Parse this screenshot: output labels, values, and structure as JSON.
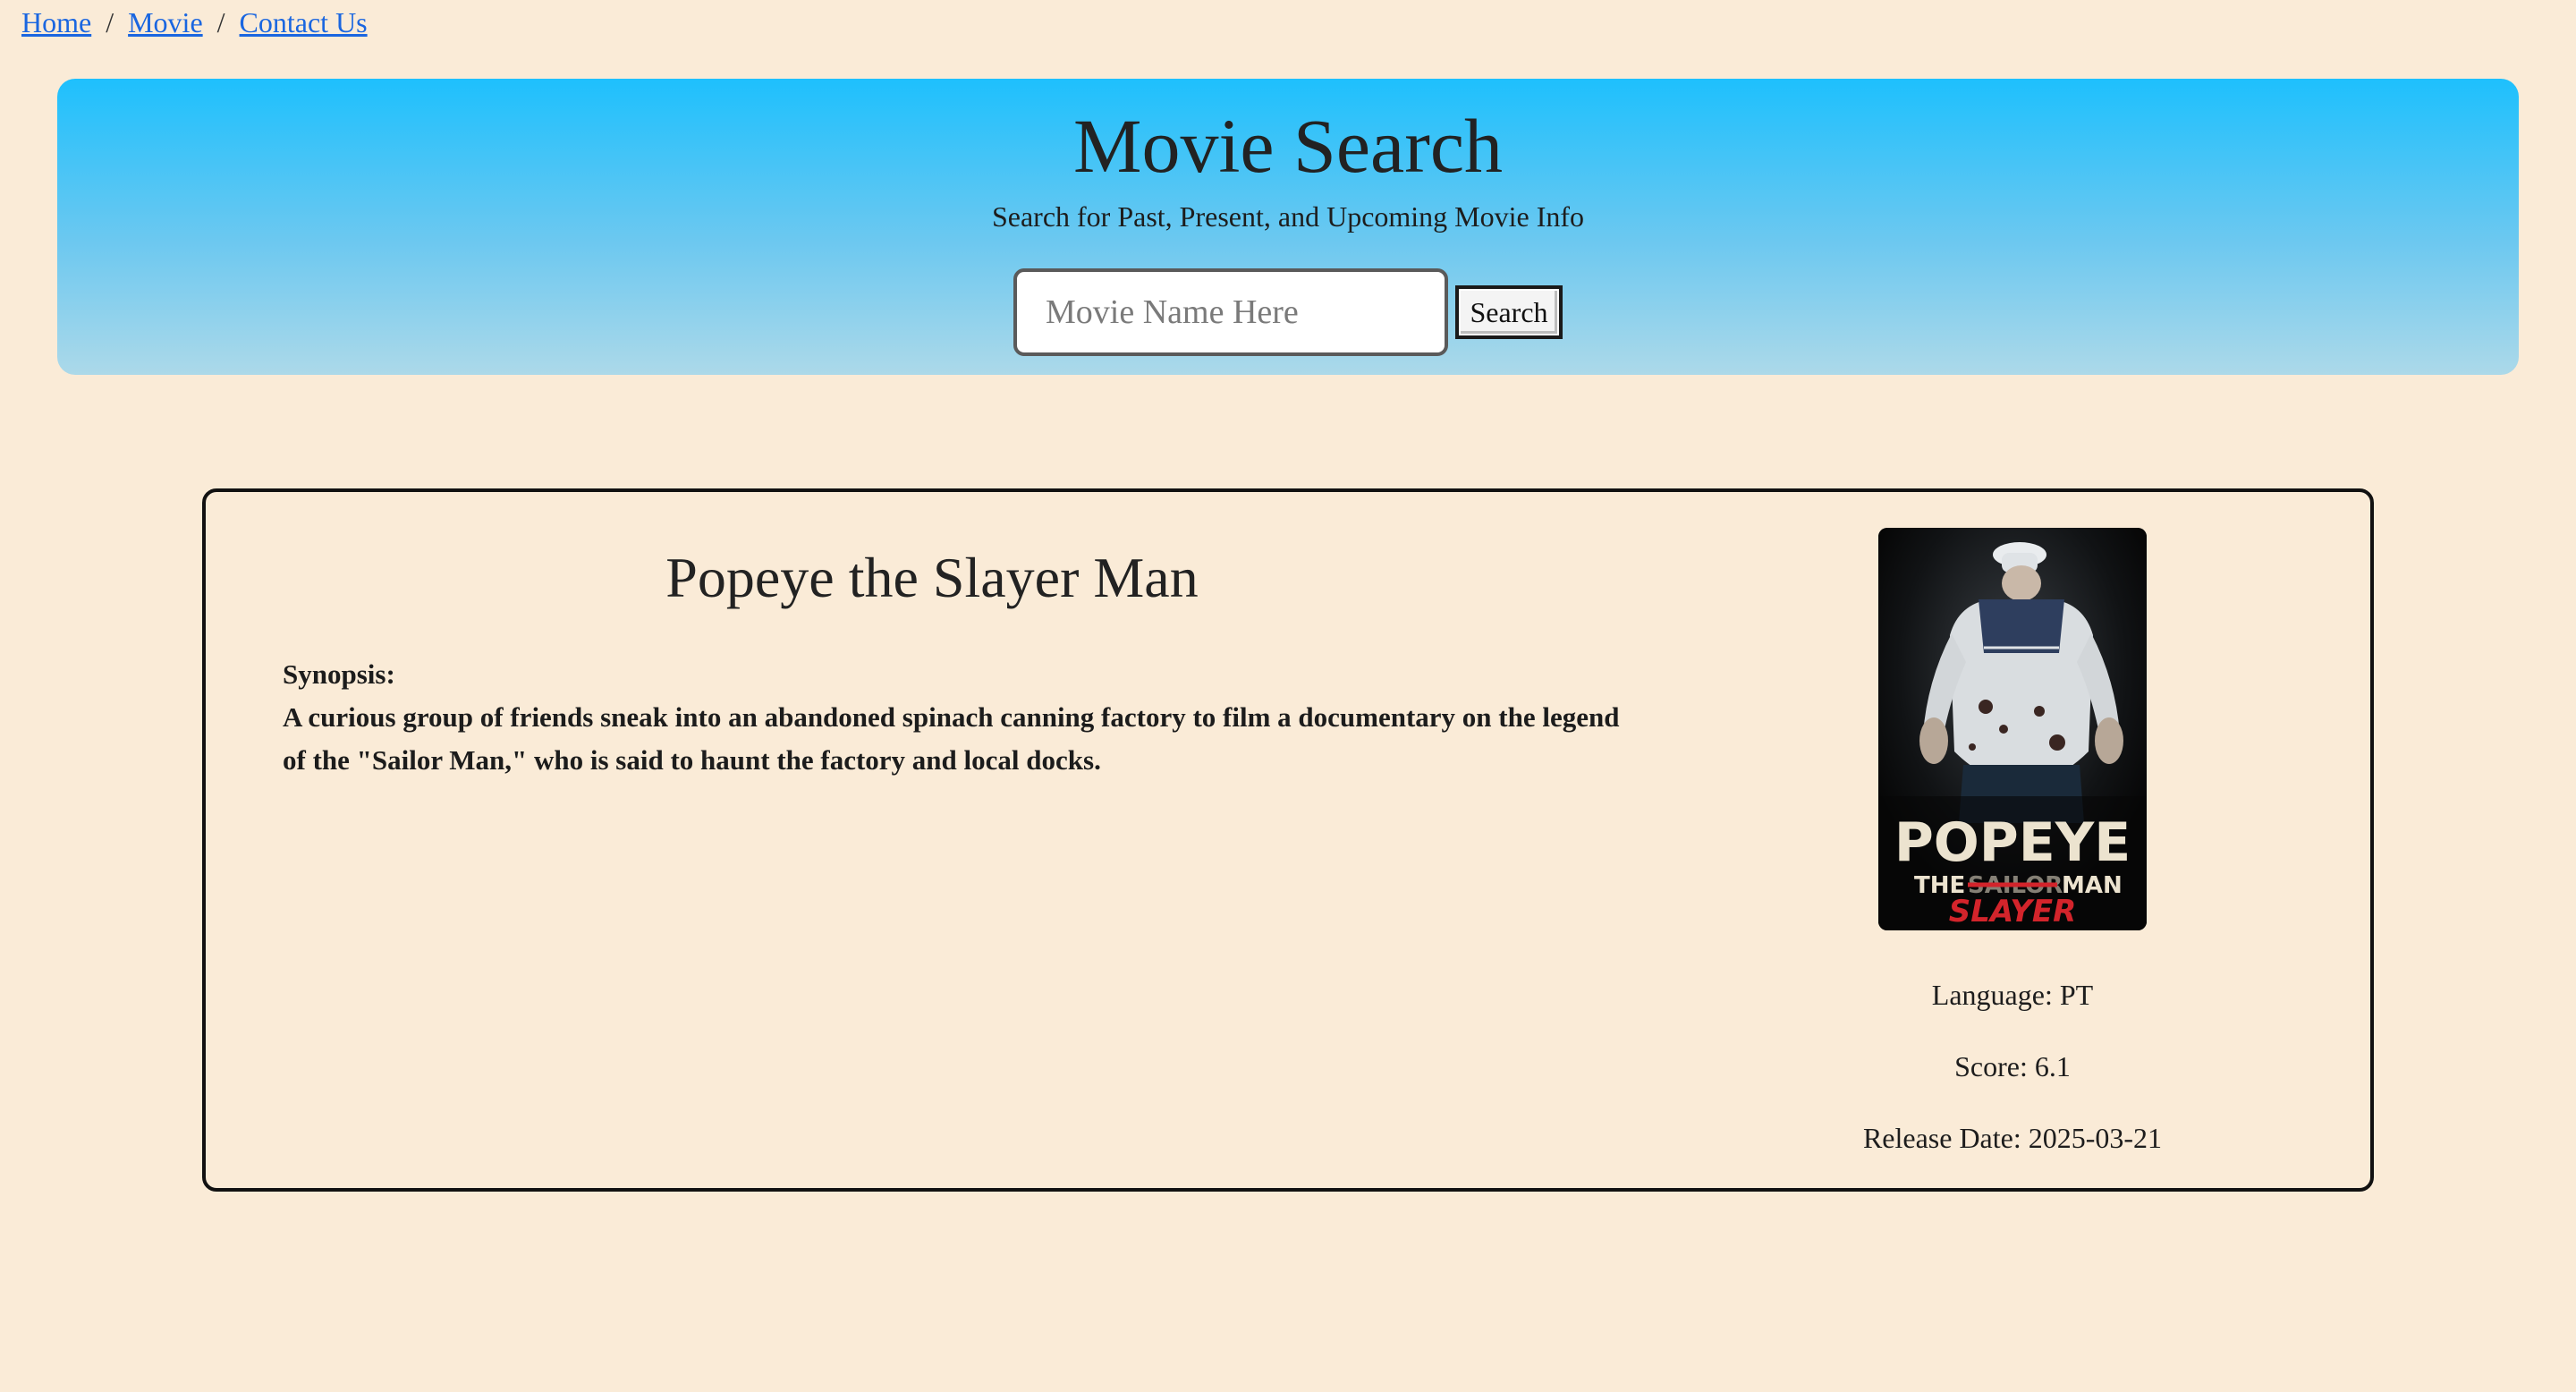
{
  "breadcrumb": {
    "items": [
      {
        "label": "Home"
      },
      {
        "label": "Movie"
      },
      {
        "label": "Contact Us"
      }
    ],
    "separator": "/"
  },
  "header": {
    "title": "Movie Search",
    "subtitle": "Search for Past, Present, and Upcoming Movie Info",
    "search_placeholder": "Movie Name Here",
    "search_value": "",
    "search_button_label": "Search"
  },
  "movie": {
    "title": "Popeye the Slayer Man",
    "synopsis_label": "Synopsis:",
    "synopsis": "A curious group of friends sneak into an abandoned spinach canning factory to film a documentary on the legend of the \"Sailor Man,\" who is said to haunt the factory and local docks.",
    "poster": {
      "line1": "POPEYE",
      "line2_the": "THE",
      "line2_struck": "SAILOR",
      "line2_man": "MAN",
      "line3": "SLAYER"
    },
    "language": "Language: PT",
    "score": "Score: 6.1",
    "release_date": "Release Date: 2025-03-21"
  },
  "colors": {
    "page_background": "#faebd7",
    "header_gradient_top": "#1ec0fd",
    "header_gradient_bottom": "#acd9e9",
    "link": "#1a66e0",
    "poster_red": "#d3242b"
  }
}
